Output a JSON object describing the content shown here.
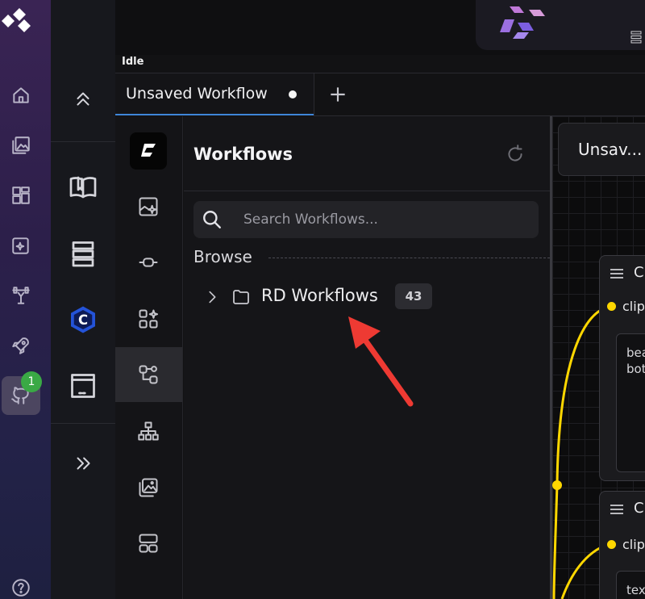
{
  "app": {
    "status": "Idle",
    "notification_count": "1"
  },
  "rail": {
    "items": [
      {
        "name": "home-icon"
      },
      {
        "name": "gallery-icon"
      },
      {
        "name": "dashboard-icon"
      },
      {
        "name": "image-sparkle-icon"
      },
      {
        "name": "training-icon"
      },
      {
        "name": "rocket-icon"
      },
      {
        "name": "github-icon",
        "active": true
      },
      {
        "name": "help-icon"
      }
    ]
  },
  "tabs": {
    "active_label": "Unsaved Workflow",
    "unsaved_marker": true,
    "add_label": "+"
  },
  "workflows_panel": {
    "title": "Workflows",
    "search_placeholder": "Search Workflows...",
    "browse_label": "Browse",
    "folders": [
      {
        "name": "RD Workflows",
        "count": "43"
      }
    ]
  },
  "canvas": {
    "workflow_name": "Unsav...",
    "nodes": [
      {
        "title": "C",
        "port": "clip",
        "text_lines": [
          "bea",
          "bot"
        ]
      },
      {
        "title": "C",
        "port": "clip",
        "text_lines": [
          "tex"
        ]
      }
    ],
    "wire_color": "#ffd700"
  },
  "annotation": {
    "arrow_color": "#ee3a33"
  }
}
